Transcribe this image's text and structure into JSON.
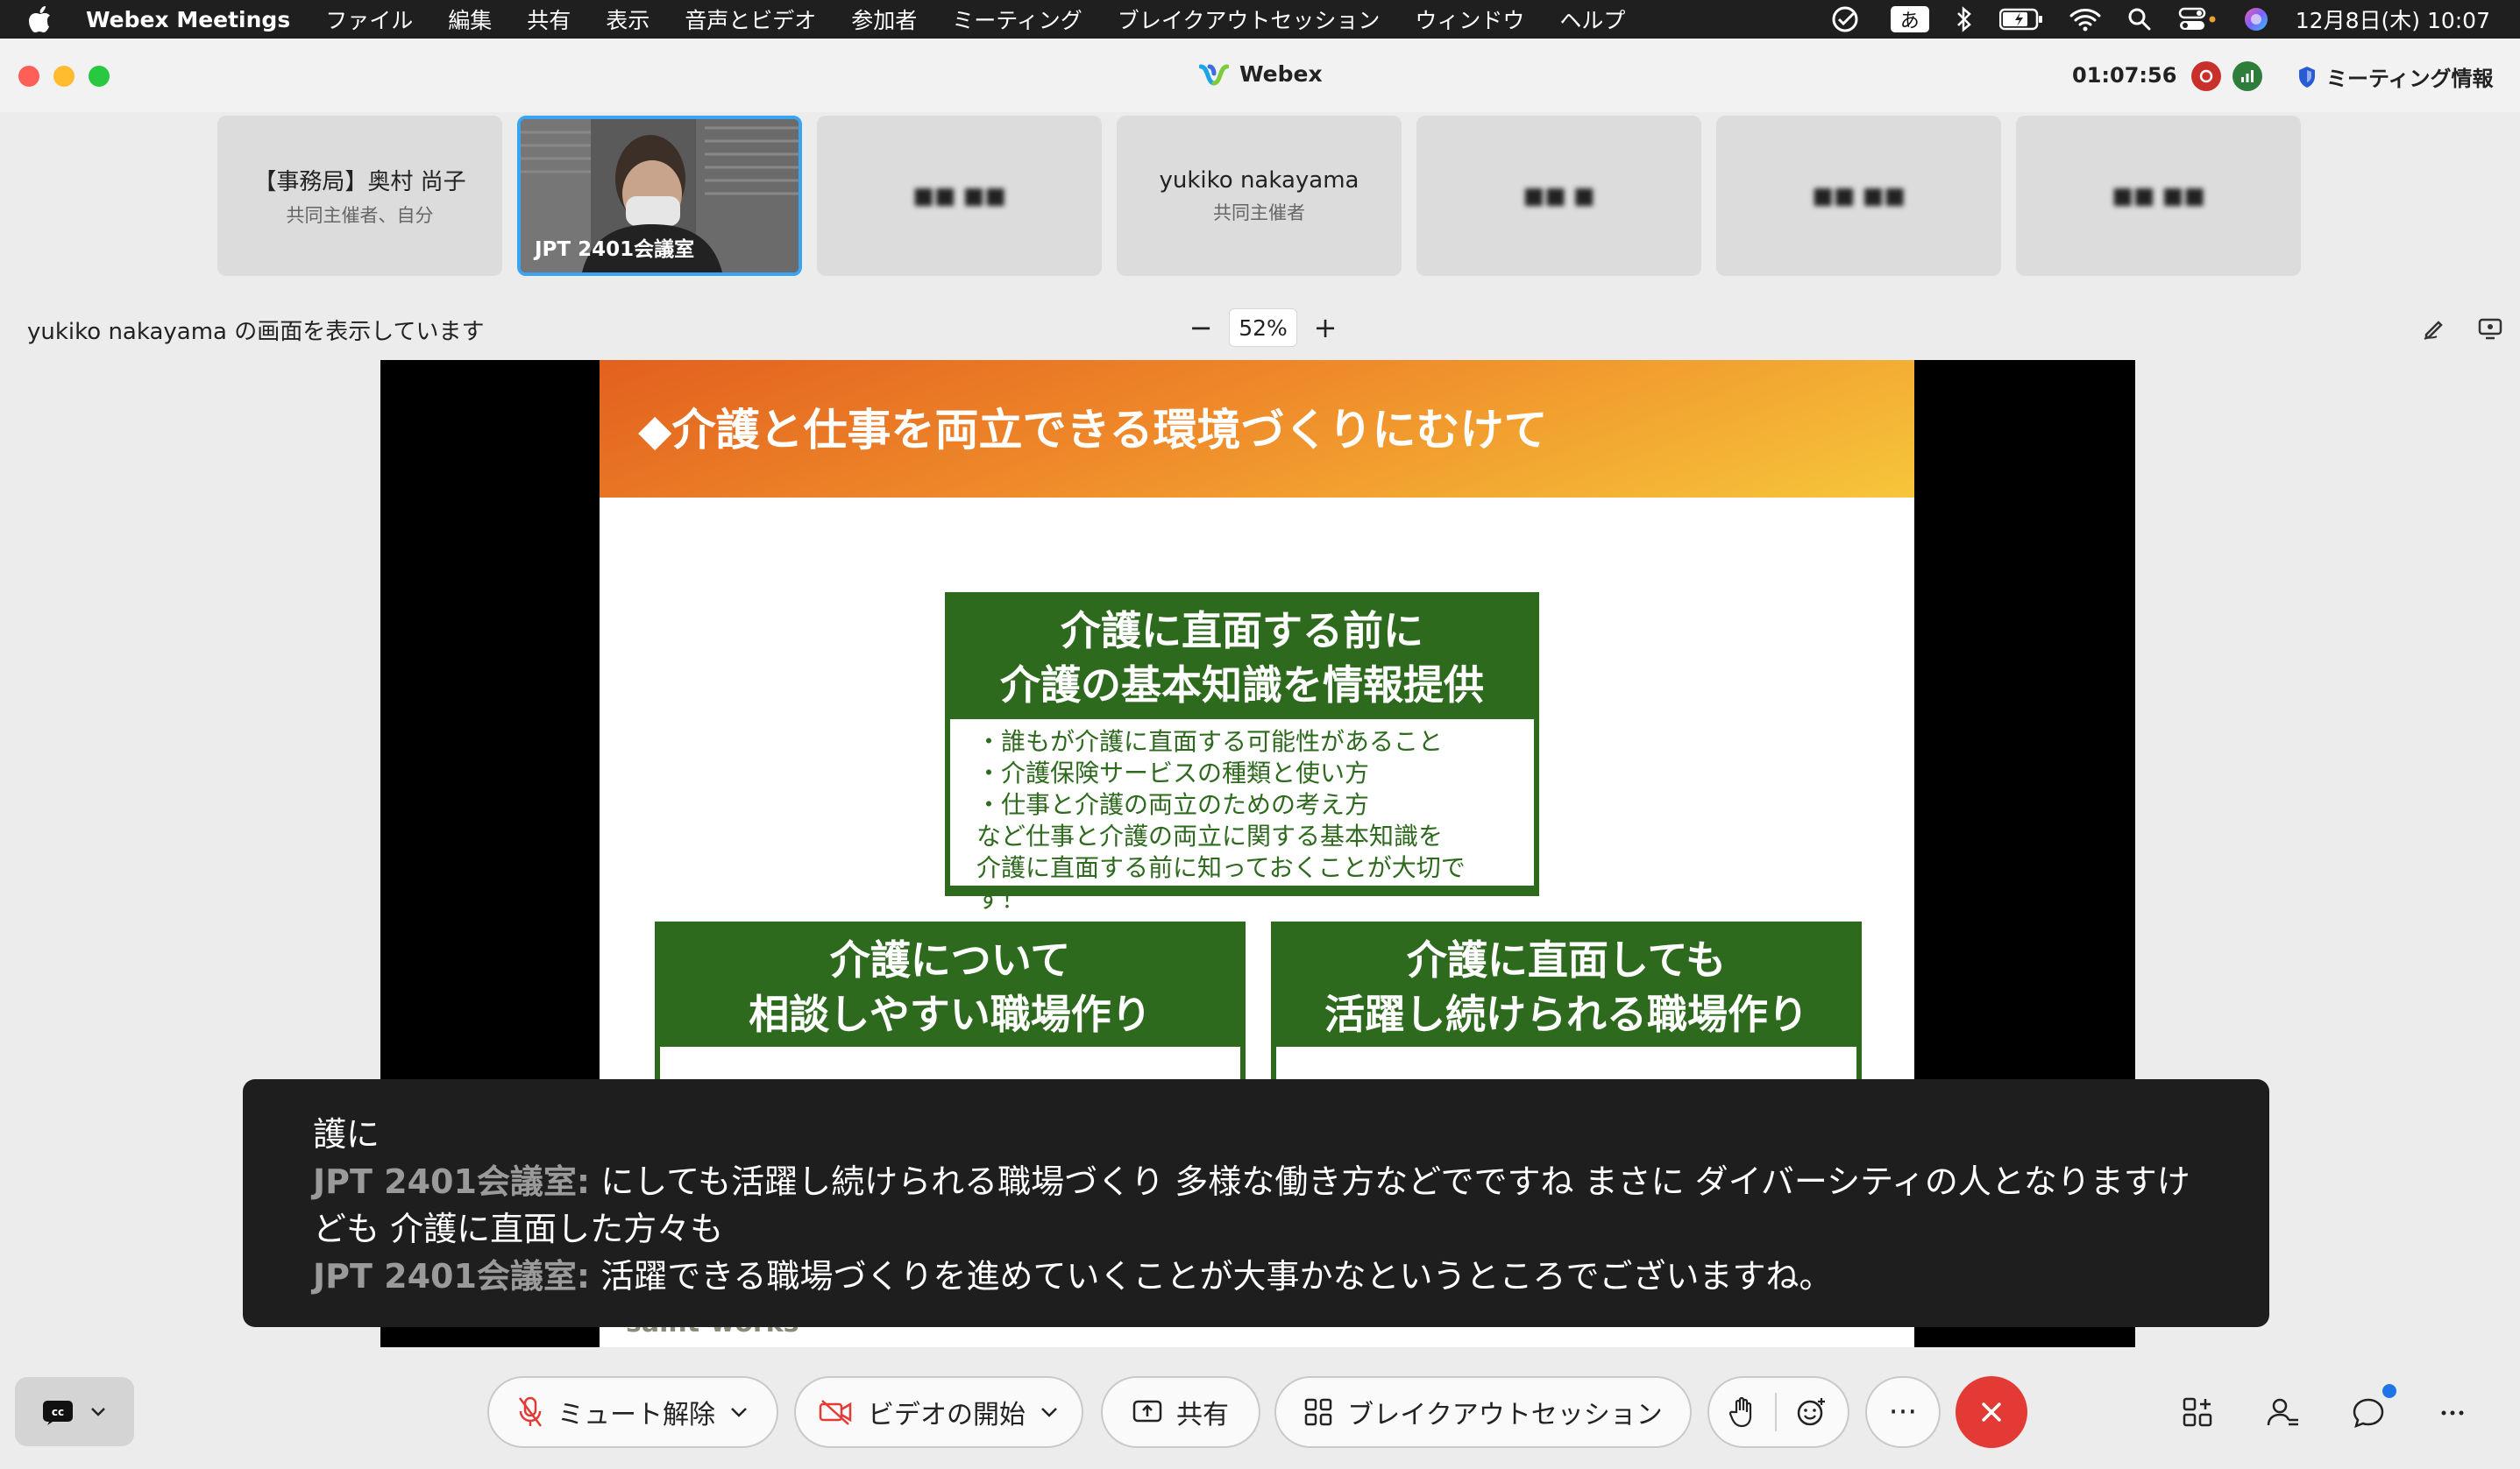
{
  "menubar": {
    "app_name": "Webex Meetings",
    "items": [
      "ファイル",
      "編集",
      "共有",
      "表示",
      "音声とビデオ",
      "参加者",
      "ミーティング",
      "ブレイクアウトセッション",
      "ウィンドウ",
      "ヘルプ"
    ],
    "ime": "あ",
    "clock": "12月8日(木) 10:07"
  },
  "window": {
    "title": "Webex",
    "timer": "01:07:56",
    "meeting_info": "ミーティング情報"
  },
  "participants": [
    {
      "name": "【事務局】奥村 尚子",
      "role": "共同主催者、自分"
    },
    {
      "name": "JPT 2401会議室",
      "role": ""
    },
    {
      "name": "■■ ■■",
      "role": ""
    },
    {
      "name": "yukiko nakayama",
      "role": "共同主催者"
    },
    {
      "name": "■■ ■",
      "role": ""
    },
    {
      "name": "■■ ■■",
      "role": ""
    },
    {
      "name": "■■ ■■",
      "role": ""
    }
  ],
  "share": {
    "sharing_text": "yukiko nakayama の画面を表示しています",
    "zoom_level": "52%",
    "zoom_minus": "−",
    "zoom_plus": "+"
  },
  "slide": {
    "title": "◆介護と仕事を両立できる環境づくりにむけて",
    "box1": {
      "head_line1": "介護に直面する前に",
      "head_line2": "介護の基本知識を情報提供",
      "body": [
        "・誰もが介護に直面する可能性があること",
        "・介護保険サービスの種類と使い方",
        "・仕事と介護の両立のための考え方",
        "など仕事と介護の両立に関する基本知識を",
        "介護に直面する前に知っておくことが大切です！"
      ]
    },
    "box2": {
      "head_line1": "介護について",
      "head_line2": "相談しやすい職場作り"
    },
    "box3": {
      "head_line1": "介護に直面しても",
      "head_line2": "活躍し続けられる職場作り"
    },
    "footer": "saint-works"
  },
  "captions": {
    "line0": "護に",
    "entries": [
      {
        "speaker": "JPT 2401会議室:",
        "text": "にしても活躍し続けられる職場づくり 多様な働き方などでですね まさに ダイバーシティの人となりますけども 介護に直面した方々も"
      },
      {
        "speaker": "JPT 2401会議室:",
        "text": "活躍できる職場づくりを進めていくことが大事かなというところでございますね。"
      }
    ]
  },
  "toolbar": {
    "mute_label": "ミュート解除",
    "video_label": "ビデオの開始",
    "share_label": "共有",
    "breakout_label": "ブレイクアウトセッション",
    "more_label": "···"
  },
  "colors": {
    "menubar_bg": "#1f1f1f",
    "slide_green": "#2d6a1d",
    "end_red": "#e43a36",
    "active_tile_border": "#3aa3f2",
    "chat_badge": "#1f74e8"
  }
}
